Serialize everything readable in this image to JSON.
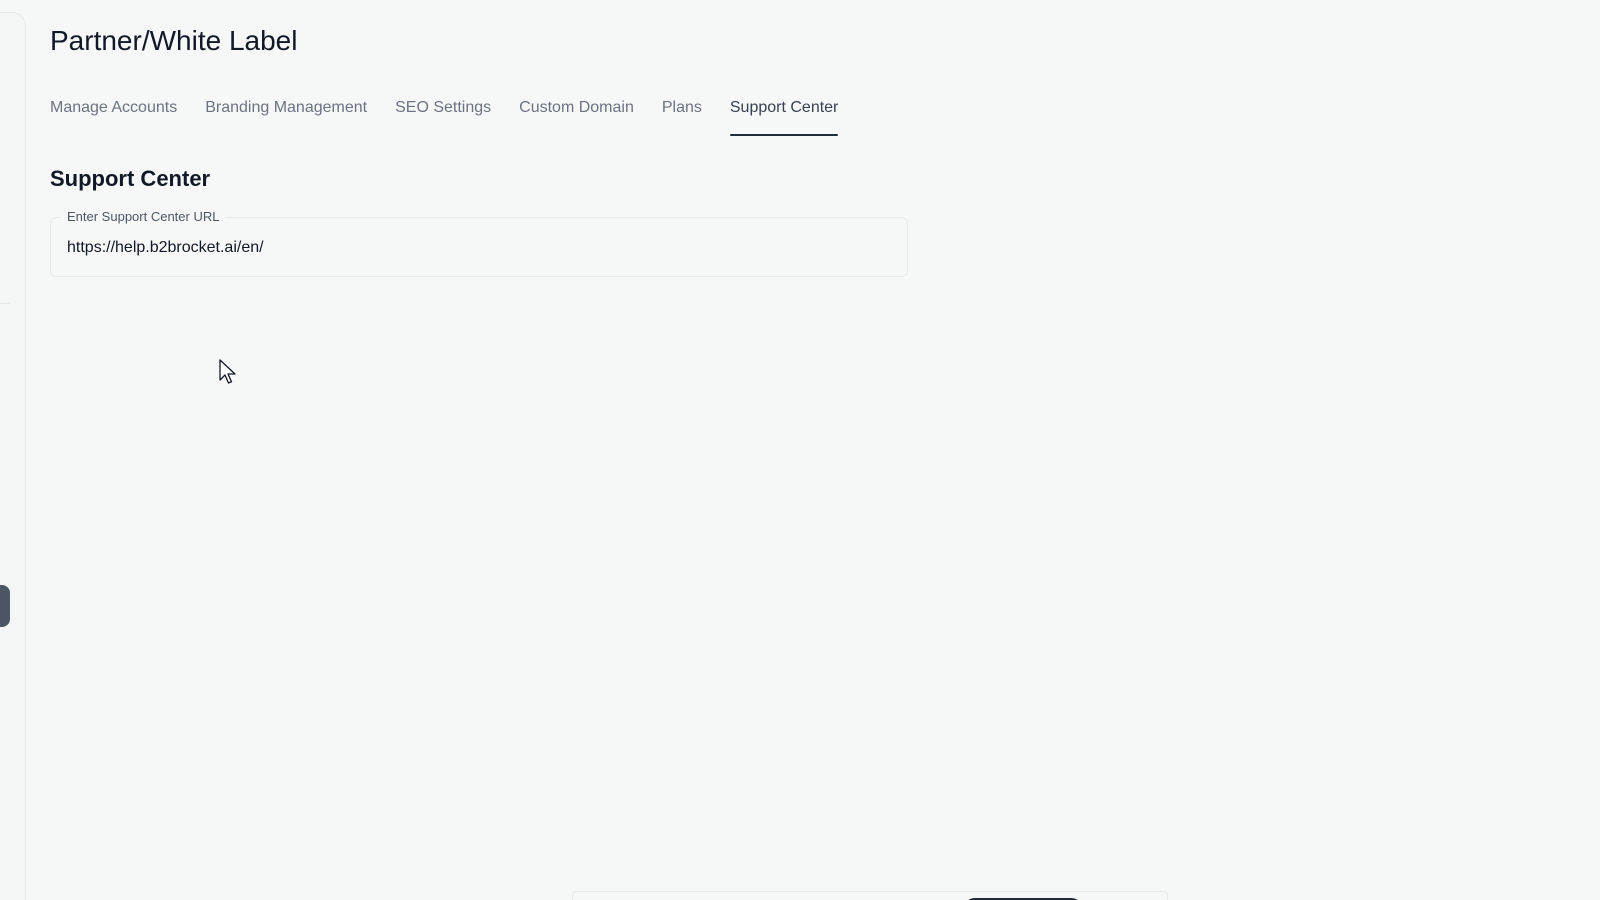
{
  "page": {
    "title": "Partner/White Label"
  },
  "tabs": [
    {
      "label": "Manage Accounts",
      "active": false
    },
    {
      "label": "Branding Management",
      "active": false
    },
    {
      "label": "SEO Settings",
      "active": false
    },
    {
      "label": "Custom Domain",
      "active": false
    },
    {
      "label": "Plans",
      "active": false
    },
    {
      "label": "Support Center",
      "active": true
    }
  ],
  "support_center": {
    "heading": "Support Center",
    "url_field": {
      "label": "Enter Support Center URL",
      "value": "https://help.b2brocket.ai/en/"
    }
  },
  "icons": {
    "cursor": "mouse-pointer-icon",
    "sidebar_more": "more-dots-icon"
  },
  "colors": {
    "background": "#f6f8f8",
    "active_tab_underline": "#1f2d3d",
    "tab_text": "#6b7280",
    "sidebar_pill": "#4b5563"
  }
}
